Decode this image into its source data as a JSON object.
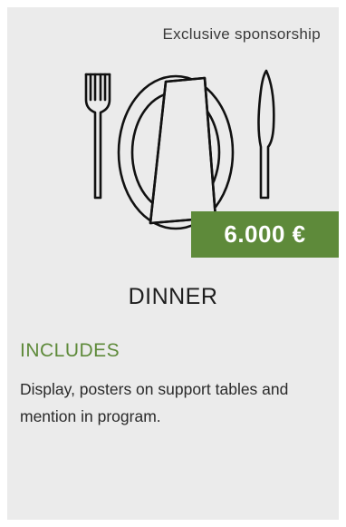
{
  "card": {
    "sponsorship_label": "Exclusive sponsorship",
    "illustration_icon": "dinner-place-setting-icon",
    "price": "6.000 €",
    "title": "DINNER",
    "includes_heading": "INCLUDES",
    "includes_text": "Display, posters on support tables and mention in program."
  },
  "colors": {
    "card_background": "#ebebeb",
    "accent_green": "#5e8a3a",
    "text_dark": "#1e1e1e"
  }
}
